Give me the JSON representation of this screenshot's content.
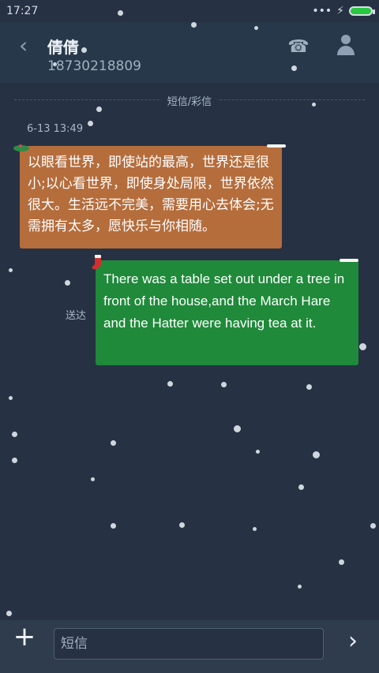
{
  "status": {
    "time": "17:27",
    "indicators": "•••",
    "charging_icon": "⚡"
  },
  "header": {
    "contact_name": "倩倩",
    "contact_number": "18730218809",
    "back_icon": "back-icon",
    "call_icon": "phone-icon",
    "profile_icon": "person-icon"
  },
  "thread": {
    "divider_label": "短信/彩信",
    "timestamp": "6-13 13:49",
    "messages": [
      {
        "direction": "incoming",
        "text": "以眼看世界，即使站的最高，世界还是很小;以心看世界，即使身处局限，世界依然很大。生活远不完美，需要用心去体会;无需拥有太多，愿快乐与你相随。"
      },
      {
        "direction": "outgoing",
        "text": "There was a table set out under a tree in front of the house,and the March Hare and the Hatter were having tea at it.",
        "status": "送达"
      }
    ]
  },
  "composer": {
    "plus_icon": "plus-icon",
    "placeholder": "短信",
    "send_icon": "send-icon"
  },
  "colors": {
    "background": "#263243",
    "incoming_bubble": "#b56d3c",
    "outgoing_bubble": "#1f8a3a",
    "battery": "#28c840"
  }
}
